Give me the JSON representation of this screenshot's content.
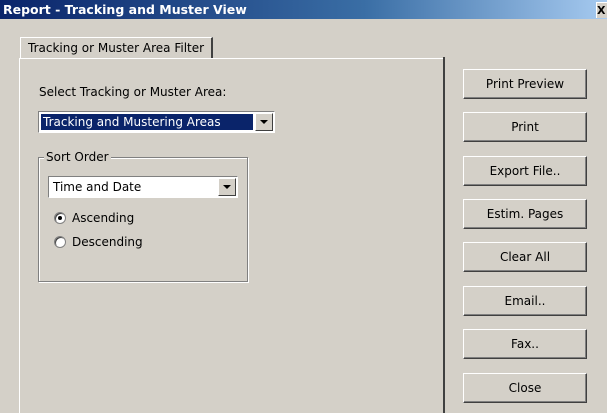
{
  "window": {
    "title": "Report  - Tracking and Muster View",
    "close_label": "X"
  },
  "tabs": [
    {
      "label": "Tracking or Muster Area Filter"
    }
  ],
  "filter": {
    "select_area_label": "Select Tracking or Muster Area:",
    "area_value": "Tracking and Mustering Areas"
  },
  "sort": {
    "legend": "Sort Order",
    "value": "Time and Date",
    "ascending_label": "Ascending",
    "descending_label": "Descending",
    "selected": "ascending"
  },
  "buttons": {
    "print_preview": "Print Preview",
    "print": "Print",
    "export_file": "Export File..",
    "estim_pages": "Estim. Pages",
    "clear_all": "Clear All",
    "email": "Email..",
    "fax": "Fax..",
    "close": "Close"
  }
}
